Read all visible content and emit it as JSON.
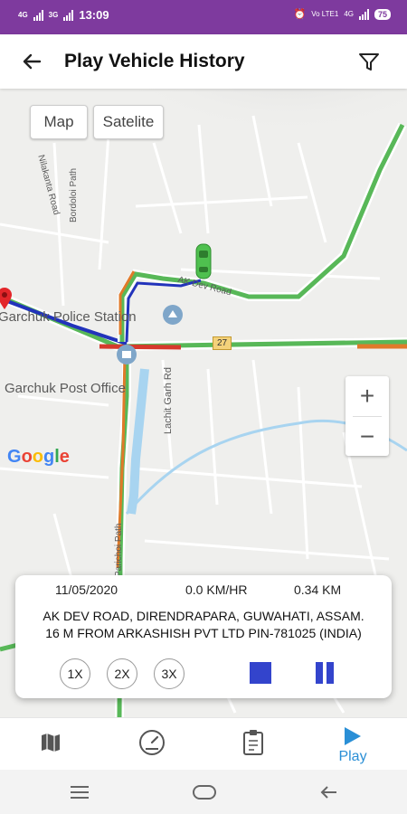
{
  "status_bar": {
    "time": "13:09",
    "left_net_1": "4G",
    "left_net_2": "3G",
    "right_net_1": "Vo LTE1",
    "right_net_2": "4G",
    "battery": "75"
  },
  "header": {
    "title": "Play Vehicle History"
  },
  "map": {
    "type_buttons": [
      "Map",
      "Satelite"
    ],
    "labels": {
      "police_station": "Garchuk Police Station",
      "post_office": "Garchuk Post Office",
      "highway_shield": "27",
      "lachit_road": "Lachit Garh Rd",
      "nilakanta_road": "Nilakanta Road",
      "bordoloi_path": "Bordoloi Path",
      "parichoi_path": "Parichoi Path",
      "ak_dev_road": "AK Dev Road"
    },
    "zoom": {
      "in": "+",
      "out": "−"
    },
    "attribution": [
      "G",
      "o",
      "o",
      "g",
      "l",
      "e"
    ],
    "attribution_colors": [
      "#4285F4",
      "#EA4335",
      "#FBBC05",
      "#4285F4",
      "#34A853",
      "#EA4335"
    ]
  },
  "info": {
    "date": "11/05/2020",
    "speed": "0.0 KM/HR",
    "distance": "0.34 KM",
    "address_line1": "AK DEV ROAD, DIRENDRAPARA, GUWAHATI, ASSAM.",
    "address_line2": "16 M FROM ARKASHISH PVT LTD PIN-781025 (INDIA)",
    "speeds": [
      "1X",
      "2X",
      "3X"
    ]
  },
  "bottom_nav": {
    "items": [
      "map-icon",
      "speedometer-icon",
      "report-icon",
      "play-icon"
    ],
    "play_label": "Play",
    "active_color": "#2a8fd6"
  },
  "colors": {
    "status_bar": "#7e3a9e",
    "control_blue": "#3344cc"
  }
}
